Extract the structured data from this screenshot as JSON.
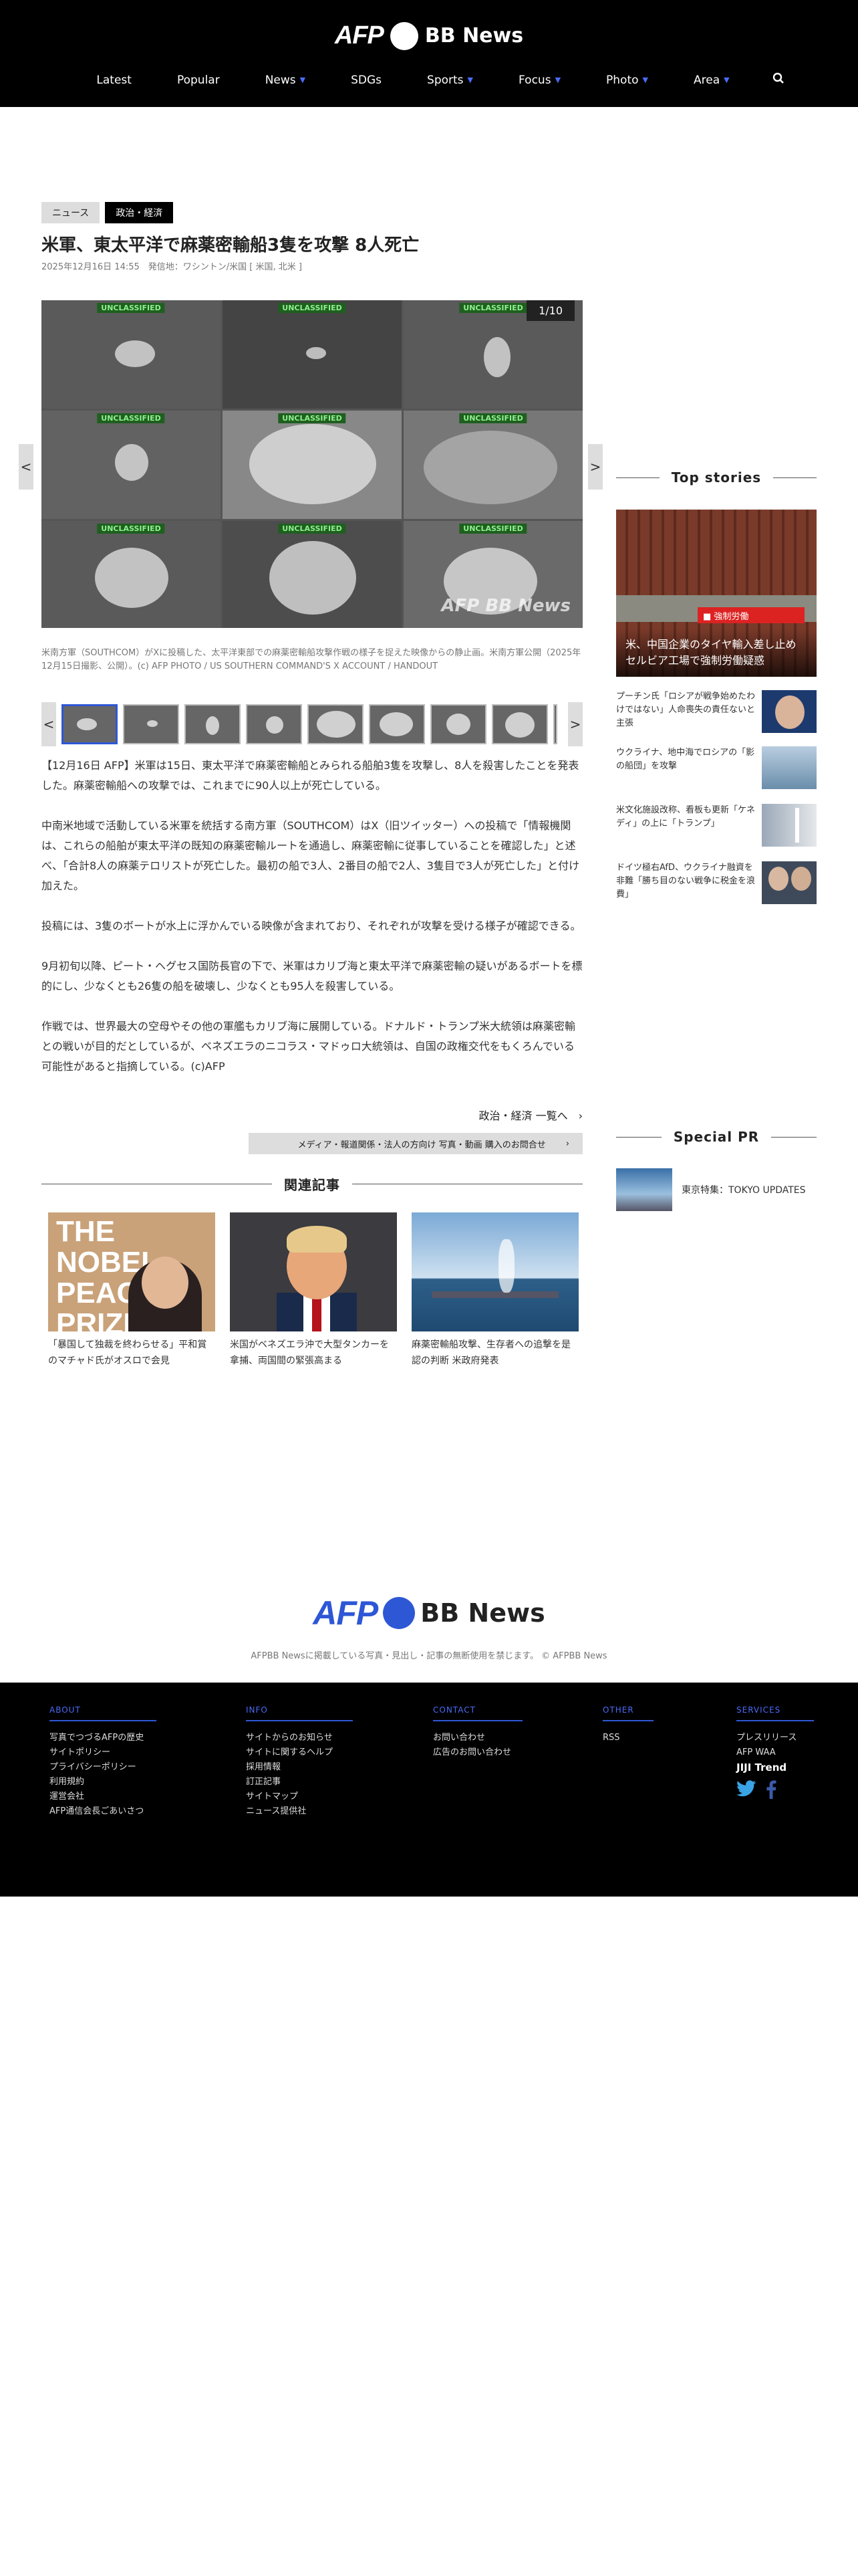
{
  "header": {
    "logo_afp": "AFP",
    "logo_bb": "BB News",
    "nav": [
      {
        "label": "Latest",
        "dropdown": false
      },
      {
        "label": "Popular",
        "dropdown": false
      },
      {
        "label": "News",
        "dropdown": true
      },
      {
        "label": "SDGs",
        "dropdown": false
      },
      {
        "label": "Sports",
        "dropdown": true
      },
      {
        "label": "Focus",
        "dropdown": true
      },
      {
        "label": "Photo",
        "dropdown": true
      },
      {
        "label": "Area",
        "dropdown": true
      }
    ],
    "search_icon": "search-icon"
  },
  "article": {
    "tag1": "ニュース",
    "tag2": "政治・経済",
    "title": "米軍、東太平洋で麻薬密輸船3隻を攻撃 8人死亡",
    "meta": "2025年12月16日 14:55　発信地：ワシントン/米国 [ 米国, 北米 ]",
    "gallery_label": "UNCLASSIFIED",
    "gallery_counter": "1/10",
    "gallery_watermark": "AFP BB News",
    "caption": "米南方軍（SOUTHCOM）がXに投稿した、太平洋東部での麻薬密輸船攻撃作戦の様子を捉えた映像からの静止画。米南方軍公開（2025年12月15日撮影、公開）。(c) AFP PHOTO / US SOUTHERN COMMAND'S X ACCOUNT / HANDOUT",
    "paragraphs": [
      "【12月16日 AFP】米軍は15日、東太平洋で麻薬密輸船とみられる船舶3隻を攻撃し、8人を殺害したことを発表した。麻薬密輸船への攻撃では、これまでに90人以上が死亡している。",
      "中南米地域で活動している米軍を統括する南方軍（SOUTHCOM）はX（旧ツイッター）への投稿で「情報機関は、これらの船舶が東太平洋の既知の麻薬密輸ルートを通過し、麻薬密輸に従事していることを確認した」と述べ、「合計8人の麻薬テロリストが死亡した。最初の船で3人、2番目の船で2人、3隻目で3人が死亡した」と付け加えた。",
      "投稿には、3隻のボートが水上に浮かんでいる映像が含まれており、それぞれが攻撃を受ける様子が確認できる。",
      "9月初旬以降、ピート・ヘグセス国防長官の下で、米軍はカリブ海と東太平洋で麻薬密輸の疑いがあるボートを標的にし、少なくとも26隻の船を破壊し、少なくとも95人を殺害している。",
      "作戦では、世界最大の空母やその他の軍艦もカリブ海に展開している。ドナルド・トランプ米大統領は麻薬密輸との戦いが目的だとしているが、ベネズエラのニコラス・マドゥロ大統領は、自国の政権交代をもくろんでいる可能性があると指摘している。(c)AFP"
    ],
    "more_link": "政治・経済 一覧へ",
    "media_bar": "メディア・報道関係・法人の方向け 写真・動画 購入のお問合せ"
  },
  "related": {
    "heading": "関連記事",
    "items": [
      {
        "caption": "「暴国して独裁を終わらせる」平和賞のマチャド氏がオスロで会見",
        "img_text": "THE NOBEL PEACE PRIZE"
      },
      {
        "caption": "米国がベネズエラ沖で大型タンカーを拿捕、両国間の緊張高まる"
      },
      {
        "caption": "麻薬密輸船攻撃、生存者への追撃を是認の判断 米政府発表"
      }
    ]
  },
  "sidebar": {
    "top_heading": "Top stories",
    "top_main": "米、中国企業のタイヤ輸入差し止め セルビア工場で強制労働疑惑",
    "top_main_banner": "■ 強制労働",
    "top_list": [
      "プーチン氏「ロシアが戦争始めたわけではない」人命喪失の責任ないと主張",
      "ウクライナ、地中海でロシアの「影の船団」を攻撃",
      "米文化施設改称、看板も更新「ケネディ」の上に「トランプ」",
      "ドイツ極右AfD、ウクライナ融資を非難「勝ち目のない戦争に税金を浪費」"
    ],
    "pr_heading": "Special PR",
    "pr_item": "東京特集：TOKYO UPDATES"
  },
  "footer": {
    "logo_afp": "AFP",
    "logo_bb": "BB News",
    "note": "AFPBB Newsに掲載している写真・見出し・記事の無断使用を禁じます。 © AFPBB News",
    "columns": [
      {
        "head": "ABOUT",
        "links": [
          "写真でつづるAFPの歴史",
          "サイトポリシー",
          "プライバシーポリシー",
          "利用規約",
          "運営会社",
          "AFP通信会長ごあいさつ"
        ]
      },
      {
        "head": "INFO",
        "links": [
          "サイトからのお知らせ",
          "サイトに関するヘルプ",
          "採用情報",
          "訂正記事",
          "サイトマップ",
          "ニュース提供社"
        ]
      },
      {
        "head": "CONTACT",
        "links": [
          "お問い合わせ",
          "広告のお問い合わせ"
        ]
      },
      {
        "head": "OTHER",
        "links": [
          "RSS"
        ]
      },
      {
        "head": "SERVICES",
        "links": [
          "プレスリリース",
          "AFP WAA",
          "JIJI Trend"
        ]
      }
    ]
  },
  "colors": {
    "brand_blue": "#2e57d6",
    "header_bg": "#000000"
  }
}
